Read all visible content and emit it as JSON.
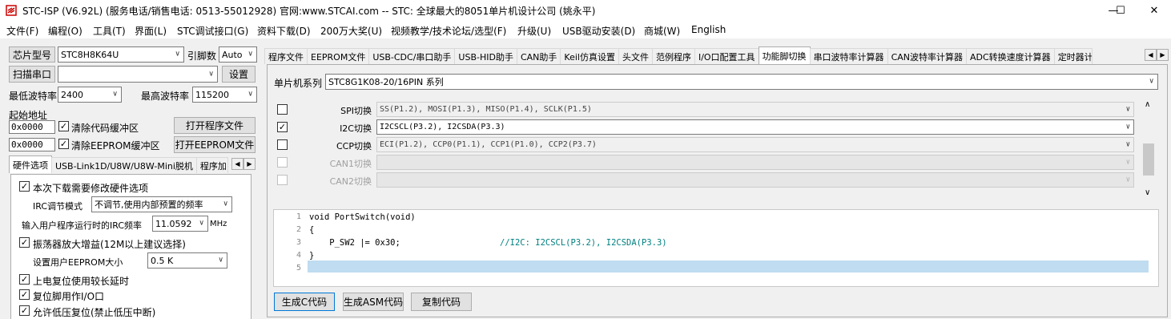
{
  "window": {
    "title": "STC-ISP (V6.92L) (服务电话/销售电话: 0513-55012928) 官网:www.STCAI.com  -- STC: 全球最大的8051单片机设计公司 (姚永平)",
    "min": "—",
    "max": "☐",
    "close": "✕"
  },
  "menu": [
    "文件(F)",
    "编程(O)",
    "工具(T)",
    "界面(L)",
    "STC调试接口(G)",
    "资料下载(D)",
    "200万大奖(U)",
    "视频教学/技术论坛/选型(F)",
    "升级(U)",
    "USB驱动安装(D)",
    "商城(W)",
    "English"
  ],
  "left": {
    "chip_label": "芯片型号",
    "chip_value": "STC8H8K64U",
    "pin_label": "引脚数",
    "pin_value": "Auto",
    "scan_button": "扫描串口",
    "port_value": "",
    "settings_button": "设置",
    "min_baud_label": "最低波特率",
    "min_baud_value": "2400",
    "max_baud_label": "最高波特率",
    "max_baud_value": "115200",
    "start_addr_label": "起始地址",
    "addr1_value": "0x0000",
    "clear_code_label": "清除代码缓冲区",
    "open_program_button": "打开程序文件",
    "addr2_value": "0x0000",
    "clear_eeprom_label": "清除EEPROM缓冲区",
    "open_eeprom_button": "打开EEPROM文件",
    "tabs": [
      "硬件选项",
      "USB-Link1D/U8W/U8W-Mini脱机",
      "程序加"
    ],
    "hw": {
      "modify_hw": "本次下载需要修改硬件选项",
      "irc_mode_label": "IRC调节模式",
      "irc_mode_value": "不调节,使用内部预置的频率",
      "irc_freq_label": "输入用户程序运行时的IRC频率",
      "irc_freq_value": "11.0592",
      "irc_freq_unit": "MHz",
      "osc_gain": "振荡器放大增益(12M以上建议选择)",
      "eeprom_size_label": "设置用户EEPROM大小",
      "eeprom_size_value": "0.5 K",
      "power_reset": "上电复位使用较长延时",
      "reset_pin": "复位脚用作I/O口",
      "low_volt_reset": "允许低压复位(禁止低压中断)"
    }
  },
  "right": {
    "tabs": [
      "程序文件",
      "EEPROM文件",
      "USB-CDC/串口助手",
      "USB-HID助手",
      "CAN助手",
      "Keil仿真设置",
      "头文件",
      "范例程序",
      "I/O口配置工具",
      "功能脚切换",
      "串口波特率计算器",
      "CAN波特率计算器",
      "ADC转换速度计算器",
      "定时器计"
    ],
    "active_tab_index": 9,
    "series_label": "单片机系列",
    "series_value": "STC8G1K08-20/16PIN 系列",
    "switches": [
      {
        "label": "SPI切换",
        "value": "SS(P1.2), MOSI(P1.3), MISO(P1.4), SCLK(P1.5)",
        "checked": false,
        "enabled": true
      },
      {
        "label": "I2C切换",
        "value": "I2CSCL(P3.2), I2CSDA(P3.3)",
        "checked": true,
        "enabled": true
      },
      {
        "label": "CCP切换",
        "value": "ECI(P1.2), CCP0(P1.1), CCP1(P1.0), CCP2(P3.7)",
        "checked": false,
        "enabled": true
      },
      {
        "label": "CAN1切换",
        "value": "",
        "checked": false,
        "enabled": false
      },
      {
        "label": "CAN2切换",
        "value": "",
        "checked": false,
        "enabled": false
      }
    ],
    "code_lines": [
      {
        "n": "1",
        "code": "void PortSwitch(void)",
        "comment": ""
      },
      {
        "n": "2",
        "code": "{",
        "comment": ""
      },
      {
        "n": "3",
        "code": "    P_SW2 |= 0x30;",
        "comment": "//I2C: I2CSCL(P3.2), I2CSDA(P3.3)"
      },
      {
        "n": "4",
        "code": "}",
        "comment": ""
      },
      {
        "n": "5",
        "code": "",
        "comment": ""
      }
    ],
    "gen_c_button": "生成C代码",
    "gen_asm_button": "生成ASM代码",
    "copy_button": "复制代码"
  },
  "colors": {
    "selected_line": "#c0dcf0",
    "comment": "#008080"
  }
}
